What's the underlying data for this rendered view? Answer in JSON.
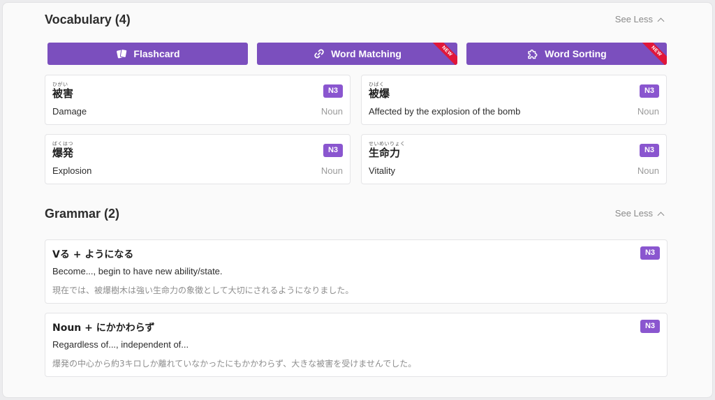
{
  "vocabulary": {
    "title": "Vocabulary (4)",
    "toggle_label": "See Less",
    "buttons": [
      {
        "label": "Flashcard",
        "icon": "cards-icon",
        "badge": ""
      },
      {
        "label": "Word Matching",
        "icon": "link-icon",
        "badge": "NEW"
      },
      {
        "label": "Word Sorting",
        "icon": "puzzle-icon",
        "badge": "NEW"
      }
    ],
    "items": [
      {
        "reading": "ひがい",
        "word": "被害",
        "level": "N3",
        "meaning": "Damage",
        "pos": "Noun"
      },
      {
        "reading": "ひばく",
        "word": "被爆",
        "level": "N3",
        "meaning": "Affected by the explosion of the bomb",
        "pos": "Noun"
      },
      {
        "reading": "ばくはつ",
        "word": "爆発",
        "level": "N3",
        "meaning": "Explosion",
        "pos": "Noun"
      },
      {
        "reading": "せいめいりょく",
        "word": "生命力",
        "level": "N3",
        "meaning": "Vitality",
        "pos": "Noun"
      }
    ]
  },
  "grammar": {
    "title": "Grammar (2)",
    "toggle_label": "See Less",
    "items": [
      {
        "pattern": "Vる + ようになる",
        "level": "N3",
        "meaning": "Become..., begin to have new ability/state.",
        "example": "現在では、被爆樹木は強い生命力の象徴として大切にされるようになりました。"
      },
      {
        "pattern": "Noun + にかかわらず",
        "level": "N3",
        "meaning": "Regardless of..., independent of...",
        "example": "爆発の中心から約3キロしか離れていなかったにもかかわらず、大きな被害を受けませんでした。"
      }
    ]
  },
  "colors": {
    "accent": "#7b4fbe",
    "badge": "#8a56cf",
    "ribbon": "#e0173a"
  }
}
